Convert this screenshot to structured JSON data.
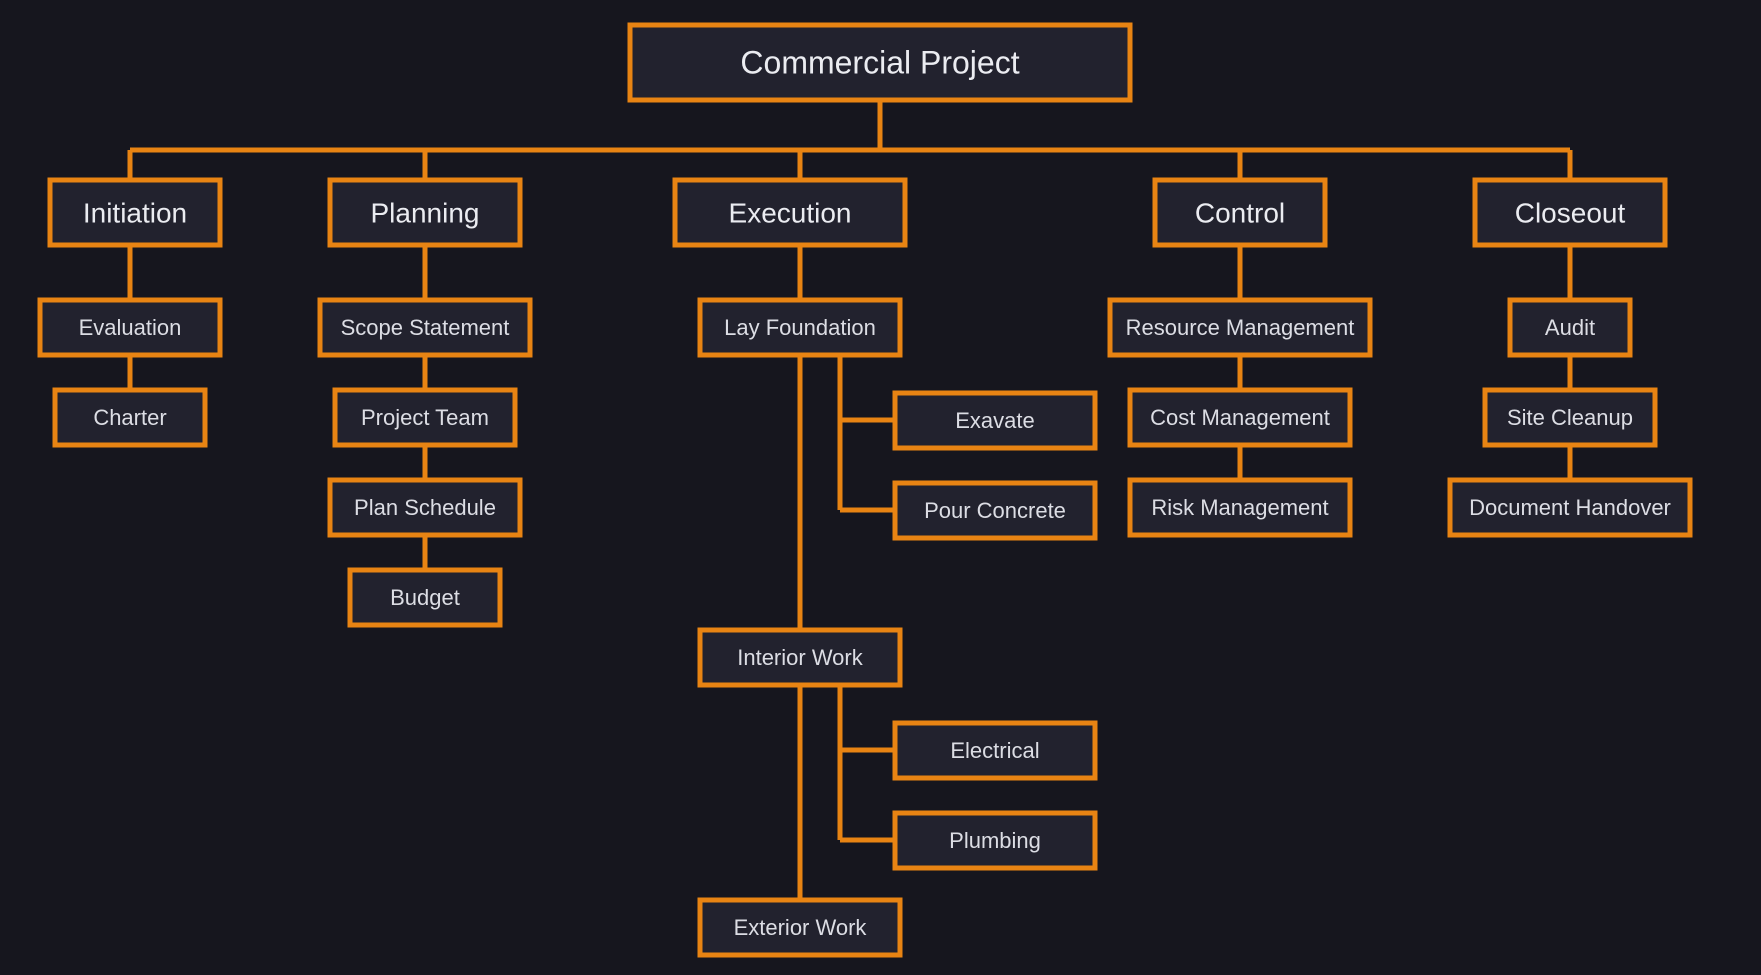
{
  "colors": {
    "accent": "#e88413",
    "node_bg": "#22222e",
    "page_bg": "#16161e"
  },
  "root": "Commercial Project",
  "phases": {
    "initiation": "Initiation",
    "planning": "Planning",
    "execution": "Execution",
    "control": "Control",
    "closeout": "Closeout"
  },
  "tasks": {
    "initiation": {
      "evaluation": "Evaluation",
      "charter": "Charter"
    },
    "planning": {
      "scope_statement": "Scope Statement",
      "project_team": "Project Team",
      "plan_schedule": "Plan Schedule",
      "budget": "Budget"
    },
    "execution": {
      "lay_foundation": "Lay Foundation",
      "exavate": "Exavate",
      "pour_concrete": "Pour Concrete",
      "interior_work": "Interior Work",
      "electrical": "Electrical",
      "plumbing": "Plumbing",
      "exterior_work": "Exterior Work"
    },
    "control": {
      "resource_management": "Resource Management",
      "cost_management": "Cost Management",
      "risk_management": "Risk Management"
    },
    "closeout": {
      "audit": "Audit",
      "site_cleanup": "Site Cleanup",
      "document_handover": "Document Handover"
    }
  }
}
